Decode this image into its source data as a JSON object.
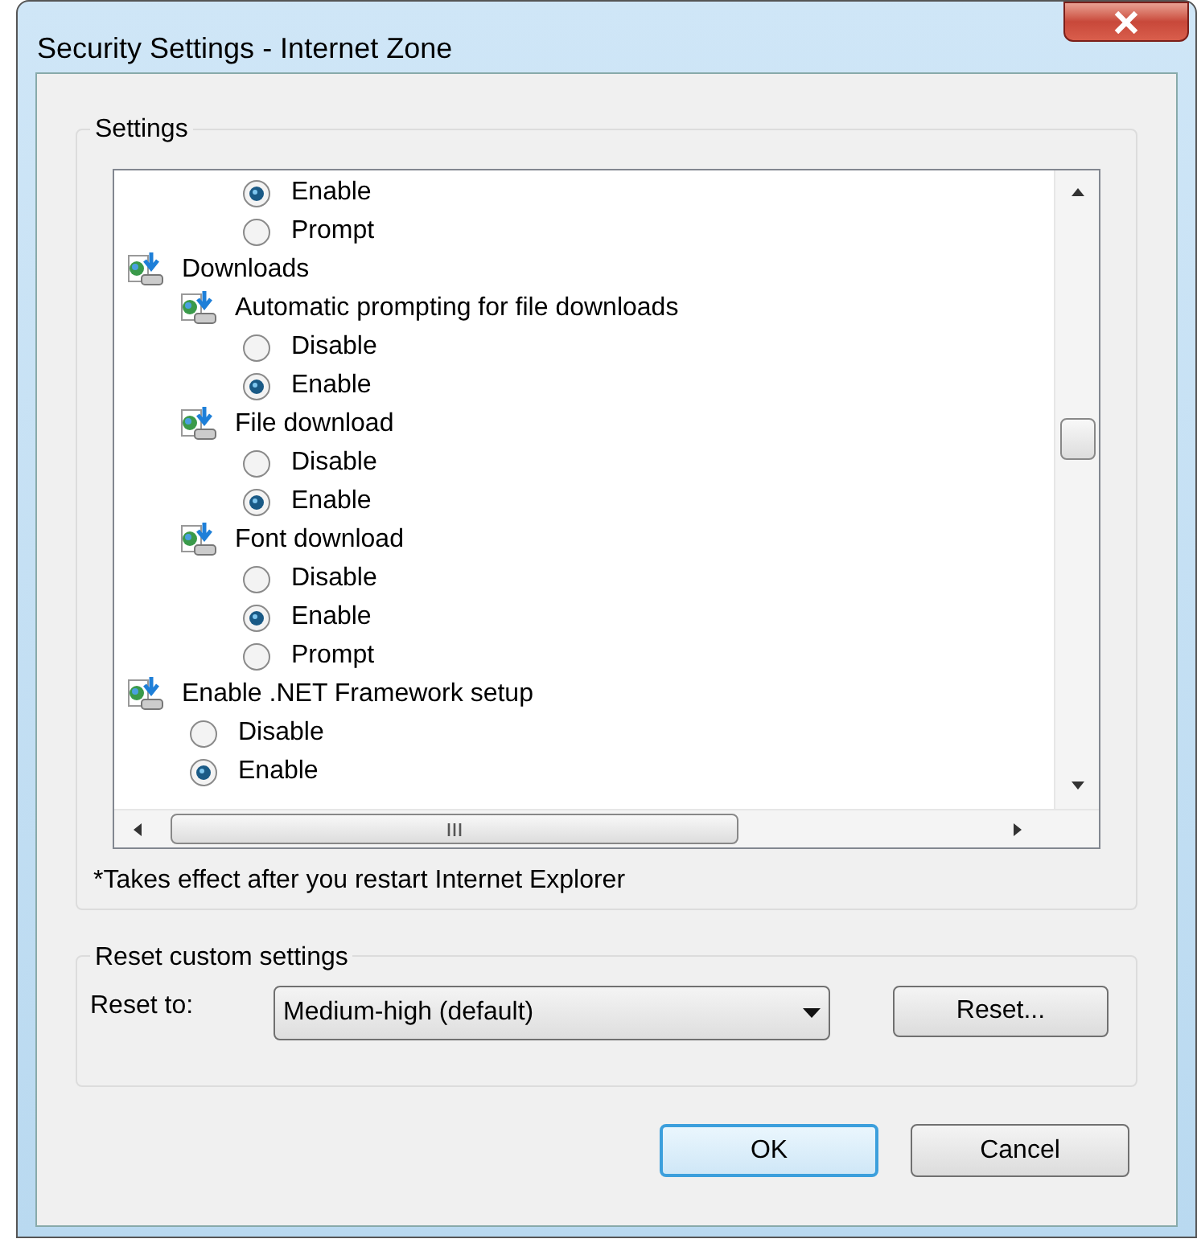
{
  "window": {
    "title": "Security Settings - Internet Zone"
  },
  "settings": {
    "label": "Settings",
    "scrolled_options": [
      {
        "label": "Enable",
        "selected": true
      },
      {
        "label": "Prompt",
        "selected": false
      }
    ],
    "tree": [
      {
        "kind": "setting",
        "label": "Downloads",
        "children": [
          {
            "kind": "setting",
            "label": "Automatic prompting for file downloads",
            "children": [
              {
                "kind": "option",
                "label": "Disable",
                "selected": false
              },
              {
                "kind": "option",
                "label": "Enable",
                "selected": true
              }
            ]
          },
          {
            "kind": "setting",
            "label": "File download",
            "children": [
              {
                "kind": "option",
                "label": "Disable",
                "selected": false
              },
              {
                "kind": "option",
                "label": "Enable",
                "selected": true
              }
            ]
          },
          {
            "kind": "setting",
            "label": "Font download",
            "children": [
              {
                "kind": "option",
                "label": "Disable",
                "selected": false
              },
              {
                "kind": "option",
                "label": "Enable",
                "selected": true
              },
              {
                "kind": "option",
                "label": "Prompt",
                "selected": false
              }
            ]
          }
        ]
      },
      {
        "kind": "setting",
        "label": "Enable .NET Framework setup",
        "children": [
          {
            "kind": "option",
            "label": "Disable",
            "selected": false
          },
          {
            "kind": "option",
            "label": "Enable",
            "selected": true
          }
        ]
      }
    ],
    "note": "*Takes effect after you restart Internet Explorer"
  },
  "reset": {
    "label": "Reset custom settings",
    "field_label": "Reset to:",
    "value": "Medium-high (default)",
    "button": "Reset..."
  },
  "buttons": [
    {
      "label": "OK",
      "default": true
    },
    {
      "label": "Cancel",
      "default": false
    }
  ]
}
